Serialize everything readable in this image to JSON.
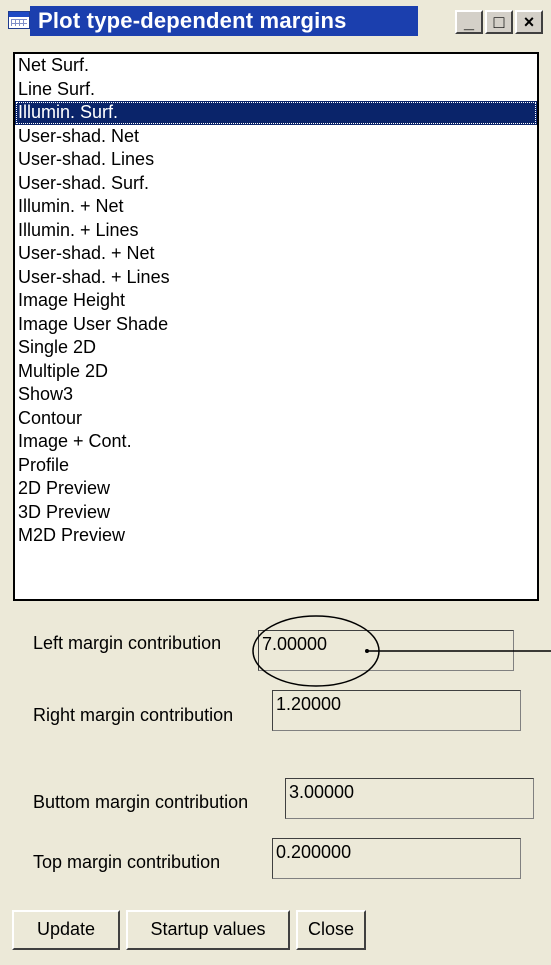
{
  "window": {
    "title": "Plot type-dependent margins",
    "controls": {
      "minimize": "_",
      "maximize": "□",
      "close": "×"
    }
  },
  "plot_types": [
    "Net Surf.",
    "Line Surf.",
    "Illumin. Surf.",
    "User-shad. Net",
    "User-shad. Lines",
    "User-shad. Surf.",
    "Illumin. + Net",
    "Illumin. + Lines",
    "User-shad. + Net",
    "User-shad. + Lines",
    "Image Height",
    "Image User Shade",
    "Single 2D",
    "Multiple 2D",
    "Show3",
    "Contour",
    "Image + Cont.",
    "Profile",
    "2D Preview",
    "3D Preview",
    "M2D Preview"
  ],
  "selected_plot_type": "Illumin. Surf.",
  "fields": {
    "left": {
      "label": "Left margin contribution",
      "value": "7.00000"
    },
    "right": {
      "label": "Right margin contribution",
      "value": "1.20000"
    },
    "bottom": {
      "label": "Buttom margin contribution",
      "value": "3.00000"
    },
    "top": {
      "label": "Top margin contribution",
      "value": "0.200000"
    }
  },
  "buttons": {
    "update": "Update",
    "startup": "Startup values",
    "close": "Close"
  }
}
